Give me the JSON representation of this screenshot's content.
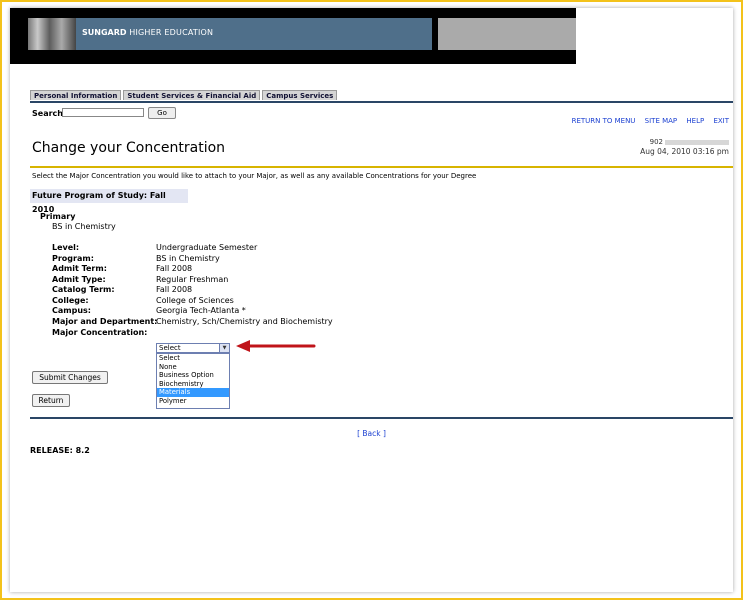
{
  "banner": {
    "logo_bold": "SUNGARD",
    "logo_rest": " HIGHER EDUCATION"
  },
  "tabs": [
    {
      "label": "Personal Information"
    },
    {
      "label": "Student Services & Financial Aid"
    },
    {
      "label": "Campus Services"
    }
  ],
  "search": {
    "label": "Search",
    "value": "",
    "go_label": "Go"
  },
  "toplinks": {
    "return_to_menu": "RETURN TO MENU",
    "site_map": "SITE MAP",
    "help": "HELP",
    "exit": "EXIT"
  },
  "header": {
    "title": "Change your Concentration",
    "user_id_prefix": "902",
    "timestamp": "Aug 04, 2010 03:16 pm"
  },
  "instructions": "Select the Major Concentration you would like to attach to your Major, as well as any available Concentrations for your Degree",
  "program": {
    "section_title": "Future Program of Study: Fall 2010",
    "primary_label": "Primary",
    "primary_value": "BS in Chemistry",
    "rows": [
      {
        "label": "Level:",
        "value": "Undergraduate Semester"
      },
      {
        "label": "Program:",
        "value": "BS in Chemistry"
      },
      {
        "label": "Admit Term:",
        "value": "Fall 2008"
      },
      {
        "label": "Admit Type:",
        "value": "Regular Freshman"
      },
      {
        "label": "Catalog Term:",
        "value": "Fall 2008"
      },
      {
        "label": "College:",
        "value": "College of Sciences"
      },
      {
        "label": "Campus:",
        "value": "Georgia Tech-Atlanta *"
      },
      {
        "label": "Major and Department:",
        "value": "Chemistry, Sch/Chemistry and Biochemistry"
      }
    ],
    "concentration_label": "Major Concentration:"
  },
  "concentration_select": {
    "selected": "Select",
    "highlighted": "Materials",
    "options": [
      "Select",
      "None",
      "Business Option",
      "Biochemistry",
      "Materials",
      "Polymer"
    ]
  },
  "actions": {
    "submit_label": "Submit Changes",
    "return_label": "Return"
  },
  "footer": {
    "back_link": "[ Back ]",
    "release": "RELEASE: 8.2"
  },
  "colors": {
    "frame": "#f3c21a",
    "banner_blue": "#4f6f8a",
    "rule_blue": "#2a4666",
    "rule_gold": "#d7b400",
    "link": "#1a3fd1",
    "highlight": "#3399ff",
    "arrow": "#c0141a"
  }
}
